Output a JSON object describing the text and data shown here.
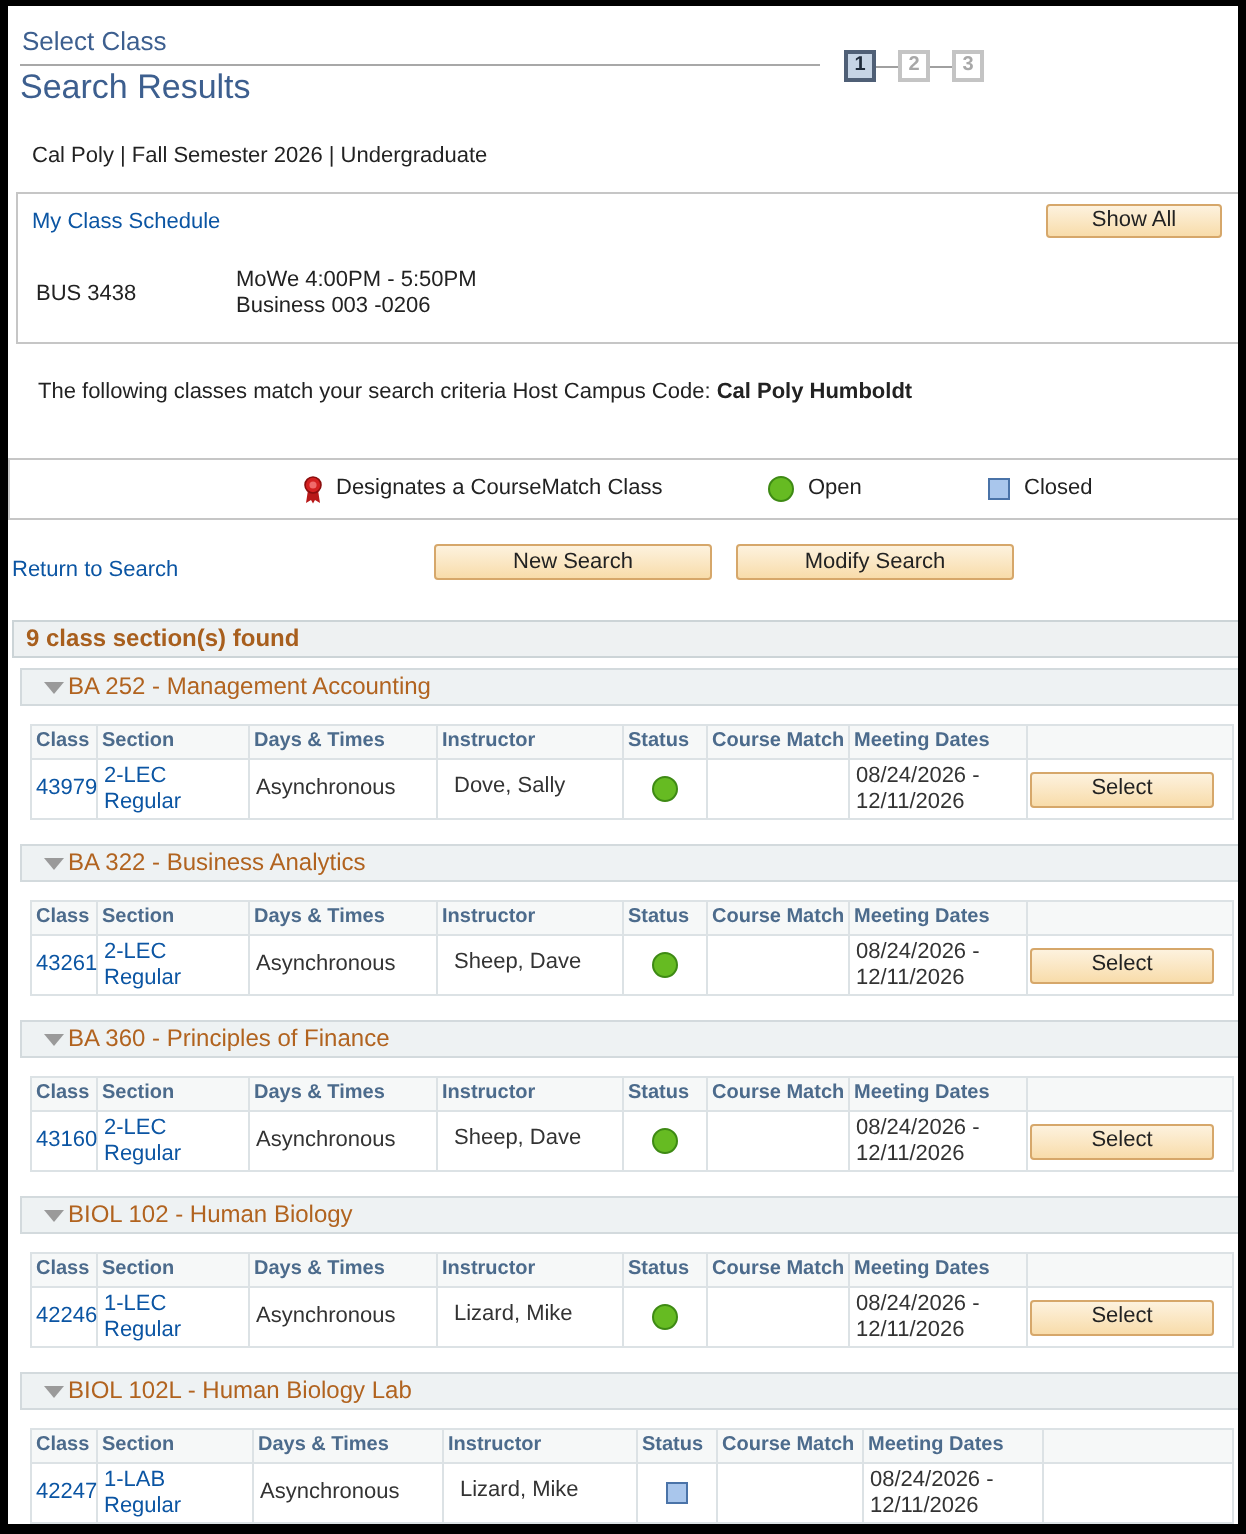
{
  "header": {
    "title": "Select Class",
    "subtitle": "Search Results",
    "steps": [
      {
        "label": "1",
        "selected": true
      },
      {
        "label": "2",
        "selected": false
      },
      {
        "label": "3",
        "selected": false
      }
    ]
  },
  "context": "Cal Poly | Fall Semester 2026 | Undergraduate",
  "schedule": {
    "link": "My Class Schedule",
    "button": "Show All",
    "entries": [
      {
        "course": "BUS 3438",
        "lines": [
          "MoWe 4:00PM - 5:50PM",
          "Business 003 -0206"
        ]
      }
    ]
  },
  "criteria": "The following classes match your search criteria Host Campus Code: **Cal Poly Humboldt**",
  "legend": [
    {
      "kind": "coursematch",
      "label": "Designates a CourseMatch Class"
    },
    {
      "kind": "open",
      "label": "Open"
    },
    {
      "kind": "closed",
      "label": "Closed"
    }
  ],
  "actions": {
    "link": "Return to Search",
    "buttons": [
      "New Search",
      "Modify Search"
    ]
  },
  "results": {
    "summary": "9 class section(s) found",
    "courses": [
      {
        "title": "BA 252 - Management Accounting",
        "expanded": true,
        "columns": [
          "Class",
          "Section",
          "Days & Times",
          "Instructor",
          "Status",
          "Course Match",
          "Meeting Dates"
        ],
        "sections": [
          {
            "class": "43979",
            "section": [
              "2-LEC",
              "Regular"
            ],
            "days_times": "Asynchronous",
            "instructor": "Dove, Sally",
            "open": true,
            "meeting_dates": [
              "08/24/2026 -",
              "12/11/2026"
            ],
            "button": "Select"
          }
        ]
      },
      {
        "title": "BA 322 - Business Analytics",
        "expanded": true,
        "columns": [
          "Class",
          "Section",
          "Days & Times",
          "Instructor",
          "Status",
          "Course Match",
          "Meeting Dates"
        ],
        "sections": [
          {
            "class": "43261",
            "section": [
              "2-LEC",
              "Regular"
            ],
            "days_times": "Asynchronous",
            "instructor": "Sheep, Dave",
            "open": true,
            "meeting_dates": [
              "08/24/2026 -",
              "12/11/2026"
            ],
            "button": "Select"
          }
        ]
      },
      {
        "title": "BA 360 - Principles of Finance",
        "expanded": true,
        "columns": [
          "Class",
          "Section",
          "Days & Times",
          "Instructor",
          "Status",
          "Course Match",
          "Meeting Dates"
        ],
        "sections": [
          {
            "class": "43160",
            "section": [
              "2-LEC",
              "Regular"
            ],
            "days_times": "Asynchronous",
            "instructor": "Sheep, Dave",
            "open": true,
            "meeting_dates": [
              "08/24/2026 -",
              "12/11/2026"
            ],
            "button": "Select"
          }
        ]
      },
      {
        "title": "BIOL 102 - Human Biology",
        "expanded": true,
        "columns": [
          "Class",
          "Section",
          "Days & Times",
          "Instructor",
          "Status",
          "Course Match",
          "Meeting Dates"
        ],
        "sections": [
          {
            "class": "42246",
            "section": [
              "1-LEC",
              "Regular"
            ],
            "days_times": "Asynchronous",
            "instructor": "Lizard, Mike",
            "open": true,
            "meeting_dates": [
              "08/24/2026 -",
              "12/11/2026"
            ],
            "button": "Select"
          }
        ]
      },
      {
        "title": "BIOL 102L - Human Biology Lab",
        "expanded": true,
        "columns": [
          "Class",
          "Section",
          "Days & Times",
          "Instructor",
          "Status",
          "Course Match",
          "Meeting Dates"
        ],
        "sections": [
          {
            "class": "42247",
            "section": [
              "1-LAB",
              "Regular"
            ],
            "days_times": "Asynchronous",
            "instructor": "Lizard, Mike",
            "open": false,
            "meeting_dates": [
              "08/24/2026 -",
              "12/11/2026"
            ]
          }
        ]
      }
    ]
  }
}
